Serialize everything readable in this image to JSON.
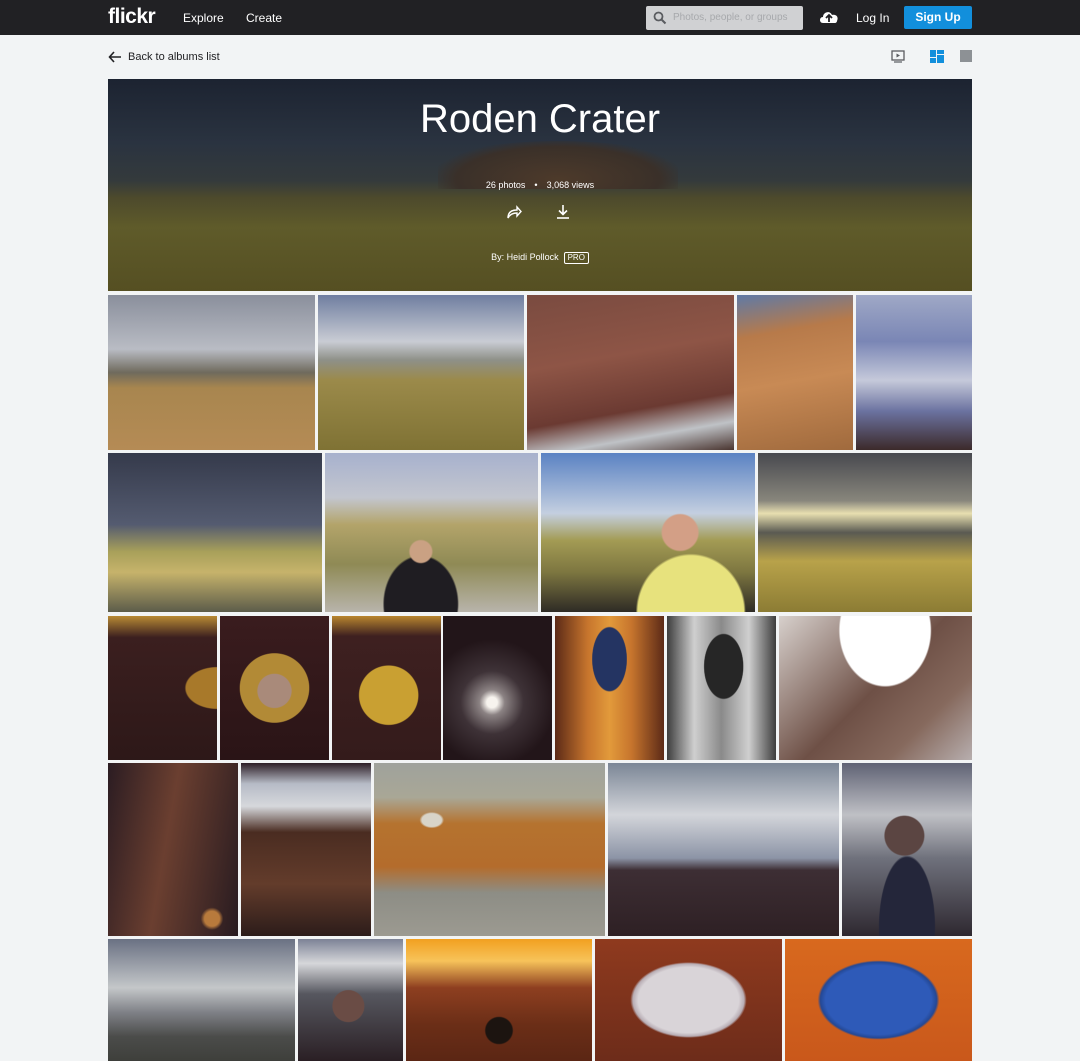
{
  "nav": {
    "logo": "flickr",
    "links": [
      "Explore",
      "Create"
    ],
    "search_placeholder": "Photos, people, or groups",
    "login_label": "Log In",
    "signup_label": "Sign Up"
  },
  "subbar": {
    "back_label": "Back to albums list",
    "view_icons": [
      "slideshow-icon",
      "grid-view-icon",
      "single-view-icon"
    ]
  },
  "album": {
    "title": "Roden Crater",
    "photo_count": "26 photos",
    "view_count": "3,068 views",
    "owner_label": "By: Heidi Pollock",
    "badge": "PRO"
  },
  "photos": [
    {
      "type": "landscape-grey-sky"
    },
    {
      "type": "landscape-cloudy-wide"
    },
    {
      "type": "red-hillside-cars"
    },
    {
      "type": "red-wall-shadow"
    },
    {
      "type": "cloudy-sky-dark"
    },
    {
      "type": "storm-field"
    },
    {
      "type": "woman-portrait-field"
    },
    {
      "type": "man-portrait-field"
    },
    {
      "type": "golden-field-storm"
    },
    {
      "type": "dark-interior-arch"
    },
    {
      "type": "woman-portrait-halo"
    },
    {
      "type": "dark-room-circle"
    },
    {
      "type": "tunnel-light"
    },
    {
      "type": "orange-corridor-oval"
    },
    {
      "type": "grey-corridor-oval"
    },
    {
      "type": "stair-ceiling"
    },
    {
      "type": "dark-corner-wall"
    },
    {
      "type": "sky-opening-wall"
    },
    {
      "type": "orange-crater-path"
    },
    {
      "type": "grey-cloud-horizon"
    },
    {
      "type": "woman-portrait-sky"
    },
    {
      "type": "hazy-field"
    },
    {
      "type": "woman-portrait-dusk"
    },
    {
      "type": "orange-dome-interior"
    },
    {
      "type": "white-oval-red"
    },
    {
      "type": "blue-oval-orange"
    }
  ]
}
